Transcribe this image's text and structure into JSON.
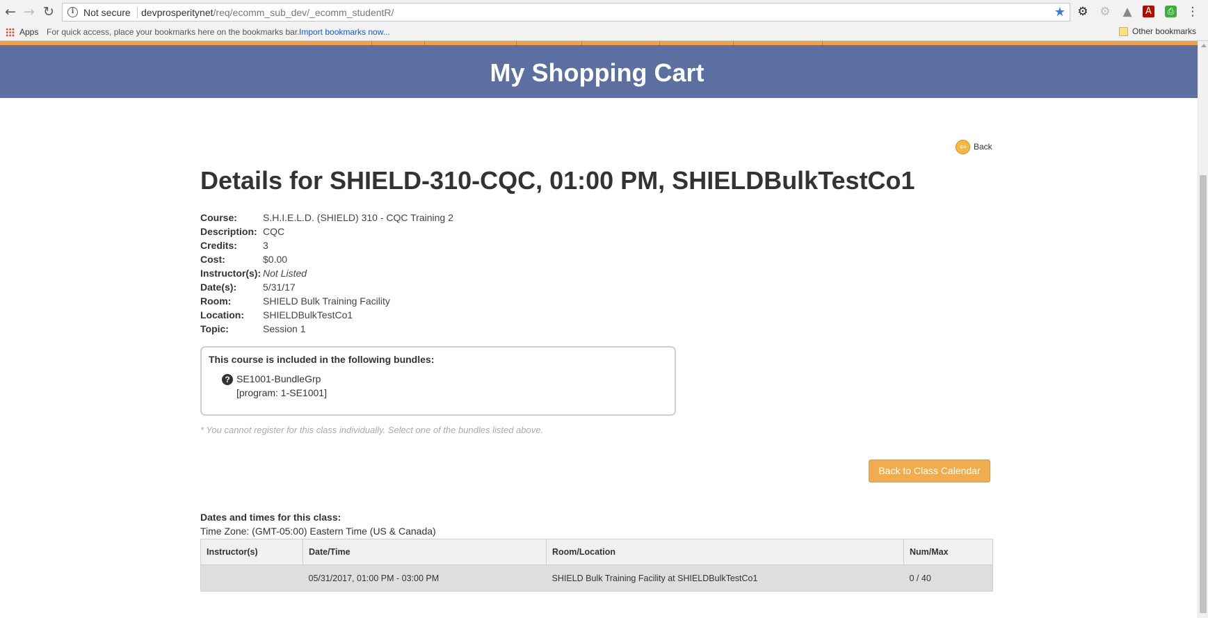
{
  "browser": {
    "security_label": "Not secure",
    "url_host": "devprosperitynet",
    "url_path": "/req/ecomm_sub_dev/_ecomm_studentR/",
    "bookmarks": {
      "apps_label": "Apps",
      "hint": "For quick access, place your bookmarks here on the bookmarks bar.",
      "import_link": "Import bookmarks now...",
      "other_label": "Other bookmarks"
    }
  },
  "colors": {
    "banner": "#5b6fa0",
    "accent_orange": "#f0ad4e",
    "strip": "#f0a045"
  },
  "page": {
    "banner_title": "My Shopping Cart",
    "back_label": "Back",
    "details_title": "Details for SHIELD-310-CQC, 01:00 PM, SHIELDBulkTestCo1",
    "details": [
      {
        "label": "Course:",
        "value": "S.H.I.E.L.D. (SHIELD) 310 - CQC Training 2"
      },
      {
        "label": "Description:",
        "value": "CQC"
      },
      {
        "label": "Credits:",
        "value": "3"
      },
      {
        "label": "Cost:",
        "value": "$0.00"
      },
      {
        "label": "Instructor(s):",
        "value": "Not Listed"
      },
      {
        "label": "Date(s):",
        "value": "5/31/17"
      },
      {
        "label": "Room:",
        "value": "SHIELD Bulk Training Facility"
      },
      {
        "label": "Location:",
        "value": "SHIELDBulkTestCo1"
      },
      {
        "label": "Topic:",
        "value": "Session 1"
      }
    ],
    "bundles": {
      "heading": "This course is included in the following bundles:",
      "items": [
        {
          "name": "SE1001-BundleGrp",
          "program": "[program: 1-SE1001]"
        }
      ]
    },
    "note": "* You cannot register for this class individually. Select one of the bundles listed above.",
    "calendar_button": "Back to Class Calendar",
    "dates_heading": "Dates and times for this class:",
    "timezone": "Time Zone: (GMT-05:00) Eastern Time (US & Canada)",
    "schedule": {
      "headers": [
        "Instructor(s)",
        "Date/Time",
        "Room/Location",
        "Num/Max"
      ],
      "rows": [
        [
          "",
          "05/31/2017, 01:00 PM - 03:00 PM",
          "SHIELD Bulk Training Facility at SHIELDBulkTestCo1",
          "0 / 40"
        ]
      ]
    }
  }
}
